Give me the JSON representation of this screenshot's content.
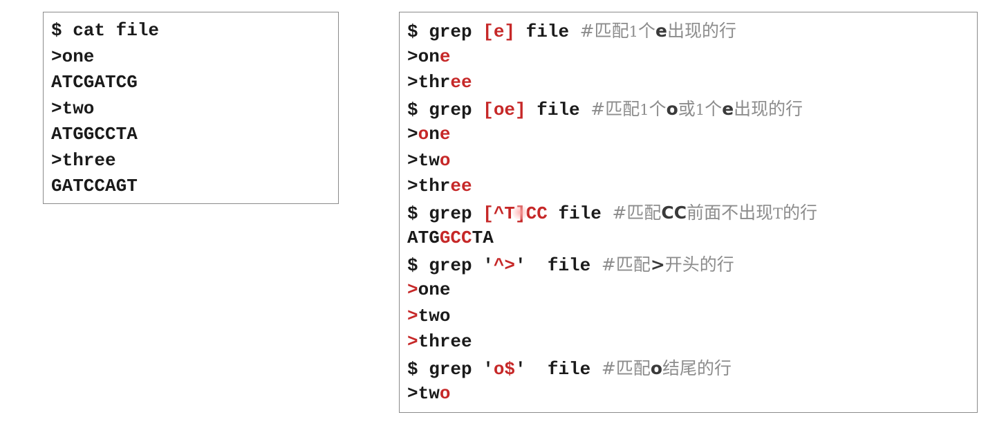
{
  "left_panel": {
    "lines": [
      [
        {
          "t": "$ cat file",
          "s": ""
        }
      ],
      [
        {
          "t": ">one",
          "s": ""
        }
      ],
      [
        {
          "t": "ATCGATCG",
          "s": ""
        }
      ],
      [
        {
          "t": ">two",
          "s": ""
        }
      ],
      [
        {
          "t": "ATGGCCTA",
          "s": ""
        }
      ],
      [
        {
          "t": ">three",
          "s": ""
        }
      ],
      [
        {
          "t": "GATCCAGT",
          "s": ""
        }
      ]
    ]
  },
  "right_panel": {
    "lines": [
      [
        {
          "t": "$ grep ",
          "s": ""
        },
        {
          "t": "[e]",
          "s": "red"
        },
        {
          "t": " file ",
          "s": ""
        },
        {
          "t": "#匹配",
          "s": "cm"
        },
        {
          "t": "1",
          "s": "cs"
        },
        {
          "t": "个",
          "s": "cm"
        },
        {
          "t": "e",
          "s": "cmd"
        },
        {
          "t": "出现的行",
          "s": "cm"
        }
      ],
      [
        {
          "t": ">on",
          "s": ""
        },
        {
          "t": "e",
          "s": "red"
        }
      ],
      [
        {
          "t": ">thr",
          "s": ""
        },
        {
          "t": "ee",
          "s": "red"
        }
      ],
      [
        {
          "t": "$ grep ",
          "s": ""
        },
        {
          "t": "[oe]",
          "s": "red"
        },
        {
          "t": " file ",
          "s": ""
        },
        {
          "t": "#匹配",
          "s": "cm"
        },
        {
          "t": "1",
          "s": "cs"
        },
        {
          "t": "个",
          "s": "cm"
        },
        {
          "t": "o",
          "s": "cmd"
        },
        {
          "t": "或",
          "s": "cm"
        },
        {
          "t": "1",
          "s": "cs"
        },
        {
          "t": "个",
          "s": "cm"
        },
        {
          "t": "e",
          "s": "cmd"
        },
        {
          "t": "出现的行",
          "s": "cm"
        }
      ],
      [
        {
          "t": ">",
          "s": ""
        },
        {
          "t": "o",
          "s": "red"
        },
        {
          "t": "n",
          "s": ""
        },
        {
          "t": "e",
          "s": "red"
        }
      ],
      [
        {
          "t": ">tw",
          "s": ""
        },
        {
          "t": "o",
          "s": "red"
        }
      ],
      [
        {
          "t": ">thr",
          "s": ""
        },
        {
          "t": "ee",
          "s": "red"
        }
      ],
      [
        {
          "t": "$ grep ",
          "s": ""
        },
        {
          "t": "[^T]CC",
          "s": "red"
        },
        {
          "t": " file ",
          "s": ""
        },
        {
          "t": "#匹配",
          "s": "cm"
        },
        {
          "t": "CC",
          "s": "cmd"
        },
        {
          "t": "前面不出现",
          "s": "cm"
        },
        {
          "t": "T",
          "s": "cs"
        },
        {
          "t": "的行",
          "s": "cm"
        }
      ],
      [
        {
          "t": "ATG",
          "s": ""
        },
        {
          "t": "GCC",
          "s": "red"
        },
        {
          "t": "TA",
          "s": ""
        }
      ],
      [
        {
          "t": "$ grep ",
          "s": ""
        },
        {
          "t": "'",
          "s": ""
        },
        {
          "t": "^>",
          "s": "red"
        },
        {
          "t": "'  file ",
          "s": ""
        },
        {
          "t": "#匹配",
          "s": "cm"
        },
        {
          "t": ">",
          "s": "cmd"
        },
        {
          "t": "开头的行",
          "s": "cm"
        }
      ],
      [
        {
          "t": ">",
          "s": "red"
        },
        {
          "t": "one",
          "s": ""
        }
      ],
      [
        {
          "t": ">",
          "s": "red"
        },
        {
          "t": "two",
          "s": ""
        }
      ],
      [
        {
          "t": ">",
          "s": "red"
        },
        {
          "t": "three",
          "s": ""
        }
      ],
      [
        {
          "t": "$ grep ",
          "s": ""
        },
        {
          "t": "'",
          "s": ""
        },
        {
          "t": "o$",
          "s": "red"
        },
        {
          "t": "'  file ",
          "s": ""
        },
        {
          "t": "#匹配",
          "s": "cm"
        },
        {
          "t": "o",
          "s": "cmd"
        },
        {
          "t": "结尾的行",
          "s": "cm"
        }
      ],
      [
        {
          "t": ">tw",
          "s": ""
        },
        {
          "t": "o",
          "s": "red"
        }
      ]
    ]
  },
  "colors": {
    "highlight": "#c62828",
    "text": "#1a1a1a",
    "comment": "#8c8c8c",
    "border": "#8a8a8a"
  }
}
